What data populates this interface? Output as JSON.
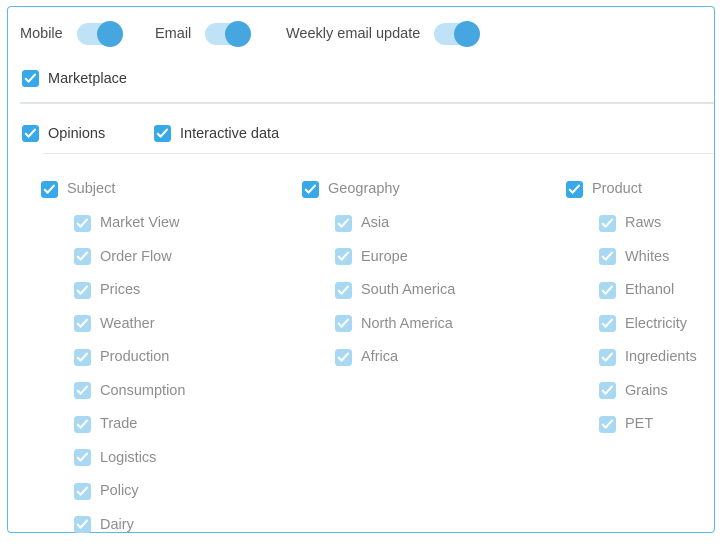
{
  "panel": {
    "border_color": "#5cb9ec",
    "accent_color": "#37a8e8",
    "accent_faded_color": "#a9d9f2"
  },
  "toggles": [
    {
      "label": "Mobile",
      "state": "on"
    },
    {
      "label": "Email",
      "state": "on"
    },
    {
      "label": "Weekly email update",
      "state": "on"
    }
  ],
  "top_checkboxes": [
    {
      "label": "Marketplace",
      "checked": true
    },
    {
      "label": "Opinions",
      "checked": true
    },
    {
      "label": "Interactive data",
      "checked": true
    }
  ],
  "columns": [
    {
      "title": "Subject",
      "checked": true,
      "items": [
        {
          "label": "Market View",
          "checked": true
        },
        {
          "label": "Order Flow",
          "checked": true
        },
        {
          "label": "Prices",
          "checked": true
        },
        {
          "label": "Weather",
          "checked": true
        },
        {
          "label": "Production",
          "checked": true
        },
        {
          "label": "Consumption",
          "checked": true
        },
        {
          "label": "Trade",
          "checked": true
        },
        {
          "label": "Logistics",
          "checked": true
        },
        {
          "label": "Policy",
          "checked": true
        },
        {
          "label": "Dairy",
          "checked": true
        }
      ]
    },
    {
      "title": "Geography",
      "checked": true,
      "items": [
        {
          "label": "Asia",
          "checked": true
        },
        {
          "label": "Europe",
          "checked": true
        },
        {
          "label": "South America",
          "checked": true
        },
        {
          "label": "North America",
          "checked": true
        },
        {
          "label": "Africa",
          "checked": true
        }
      ]
    },
    {
      "title": "Product",
      "checked": true,
      "items": [
        {
          "label": "Raws",
          "checked": true
        },
        {
          "label": "Whites",
          "checked": true
        },
        {
          "label": "Ethanol",
          "checked": true
        },
        {
          "label": "Electricity",
          "checked": true
        },
        {
          "label": "Ingredients",
          "checked": true
        },
        {
          "label": "Grains",
          "checked": true
        },
        {
          "label": "PET",
          "checked": true
        }
      ]
    }
  ]
}
